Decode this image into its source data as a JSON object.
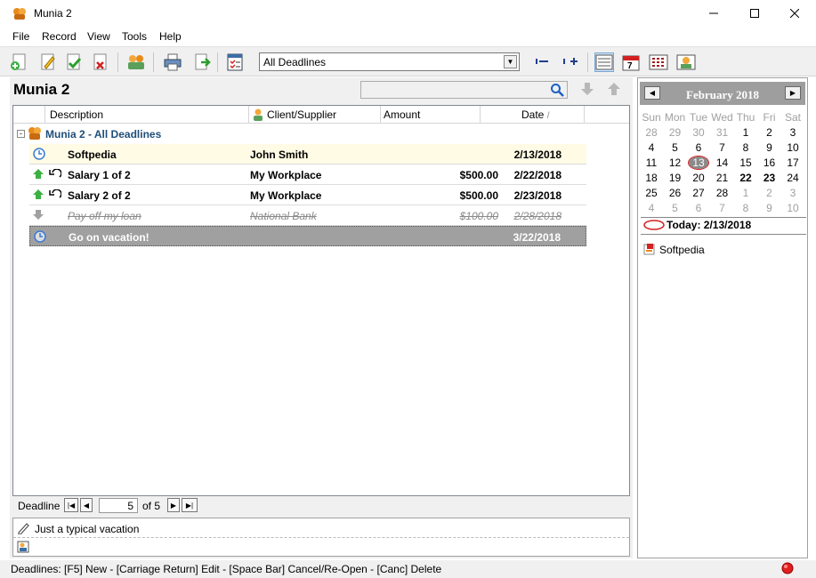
{
  "window": {
    "title": "Munia 2"
  },
  "menu": [
    "File",
    "Record",
    "View",
    "Tools",
    "Help"
  ],
  "toolbar": {
    "filter_value": "All Deadlines"
  },
  "section": {
    "title": "Munia 2",
    "search_placeholder": ""
  },
  "grid": {
    "columns": [
      "Description",
      "Client/Supplier",
      "Amount",
      "Date"
    ],
    "group_label": "Munia 2 - All Deadlines",
    "rows": [
      {
        "description": "Softpedia",
        "client": "John Smith",
        "amount": "",
        "date": "2/13/2018",
        "status": "today"
      },
      {
        "description": "Salary 1 of 2",
        "client": "My Workplace",
        "amount": "$500.00",
        "date": "2/22/2018",
        "status": "income"
      },
      {
        "description": "Salary 2 of 2",
        "client": "My Workplace",
        "amount": "$500.00",
        "date": "2/23/2018",
        "status": "income"
      },
      {
        "description": "Pay off my loan",
        "client": "National Bank",
        "amount": "$100.00",
        "date": "2/28/2018",
        "status": "cancelled"
      },
      {
        "description": "Go on vacation!",
        "client": "",
        "amount": "",
        "date": "3/22/2018",
        "status": "selected"
      }
    ]
  },
  "navigator": {
    "label": "Deadline",
    "current": "5",
    "total": "of 5"
  },
  "note": {
    "text": "Just a typical vacation"
  },
  "calendar": {
    "month": "February 2018",
    "weekdays": [
      "Sun",
      "Mon",
      "Tue",
      "Wed",
      "Thu",
      "Fri",
      "Sat"
    ],
    "weeks": [
      [
        "28",
        "29",
        "30",
        "31",
        "1",
        "2",
        "3"
      ],
      [
        "4",
        "5",
        "6",
        "7",
        "8",
        "9",
        "10"
      ],
      [
        "11",
        "12",
        "13",
        "14",
        "15",
        "16",
        "17"
      ],
      [
        "18",
        "19",
        "20",
        "21",
        "22",
        "23",
        "24"
      ],
      [
        "25",
        "26",
        "27",
        "28",
        "1",
        "2",
        "3"
      ],
      [
        "4",
        "5",
        "6",
        "7",
        "8",
        "9",
        "10"
      ]
    ],
    "today_label": "Today: 2/13/2018"
  },
  "agenda": {
    "item": "Softpedia"
  },
  "status_bar": {
    "text": "Deadlines: [F5] New - [Carriage Return] Edit - [Space Bar] Cancel/Re-Open - [Canc] Delete"
  },
  "colors": {
    "accent_header": "#1f4e79",
    "selected_row": "#a0a0a0",
    "today_row": "#fffbe5",
    "status_icon": "#e02020"
  }
}
